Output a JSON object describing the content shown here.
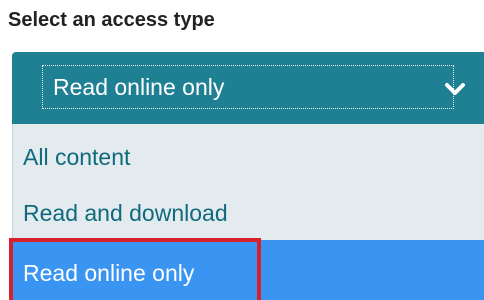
{
  "label": "Select an access type",
  "select": {
    "value": "Read online only",
    "icon": "chevron-down-icon",
    "background": "#1f7f93"
  },
  "options": [
    {
      "label": "All content"
    },
    {
      "label": "Read and download"
    },
    {
      "label": "Read online only",
      "highlighted": true
    }
  ],
  "colors": {
    "option_text": "#0f6a7e",
    "dropdown_bg": "#e4ebee",
    "highlight_bg": "#3a95f2",
    "annotation_border": "#d9202a"
  }
}
